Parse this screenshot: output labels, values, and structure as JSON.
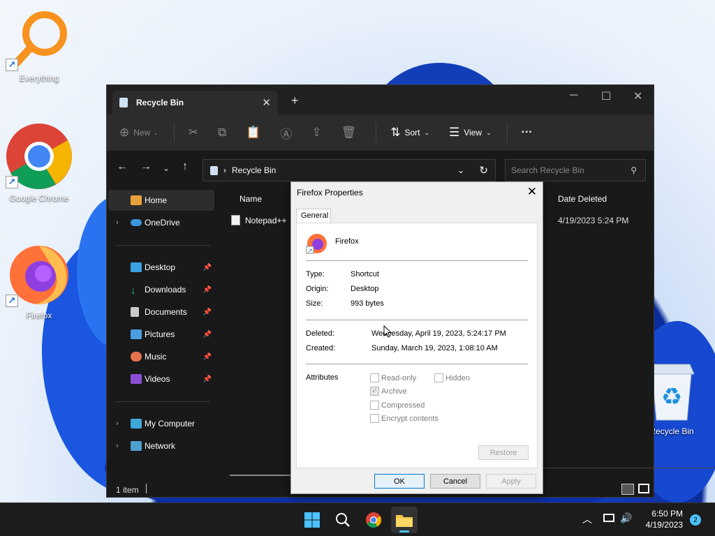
{
  "desktop": {
    "icons": [
      {
        "label": "Everything",
        "icon": "magnifier-icon"
      },
      {
        "label": "Google Chrome",
        "icon": "chrome-icon"
      },
      {
        "label": "Firefox",
        "icon": "firefox-icon"
      },
      {
        "label": "Recycle Bin",
        "icon": "recycle-bin-icon"
      }
    ]
  },
  "explorer": {
    "tab_title": "Recycle Bin",
    "toolbar": {
      "new_label": "New",
      "sort_label": "Sort",
      "view_label": "View",
      "more_label": "···"
    },
    "address": {
      "path": "Recycle Bin"
    },
    "search_placeholder": "Search Recycle Bin",
    "sidebar": {
      "items": [
        {
          "label": "Home"
        },
        {
          "label": "OneDrive"
        },
        {
          "label": "Desktop"
        },
        {
          "label": "Downloads"
        },
        {
          "label": "Documents"
        },
        {
          "label": "Pictures"
        },
        {
          "label": "Music"
        },
        {
          "label": "Videos"
        },
        {
          "label": "My Computer"
        },
        {
          "label": "Network"
        }
      ]
    },
    "columns": {
      "name": "Name",
      "date_deleted": "Date Deleted"
    },
    "files": [
      {
        "name": "Notepad++",
        "date_deleted": "4/19/2023 5:24 PM"
      }
    ],
    "status": "1 item"
  },
  "dialog": {
    "title": "Firefox Properties",
    "tab": "General",
    "file_name": "Firefox",
    "type_label": "Type:",
    "type_value": "Shortcut",
    "origin_label": "Origin:",
    "origin_value": "Desktop",
    "size_label": "Size:",
    "size_value": "993 bytes",
    "deleted_label": "Deleted:",
    "deleted_value": "Wednesday, April 19, 2023, 5:24:17 PM",
    "created_label": "Created:",
    "created_value": "Sunday, March 19, 2023, 1:08:10 AM",
    "attributes_label": "Attributes",
    "attr_readonly": "Read-only",
    "attr_hidden": "Hidden",
    "attr_archive": "Archive",
    "attr_compressed": "Compressed",
    "attr_encrypt": "Encrypt contents",
    "restore_label": "Restore",
    "ok_label": "OK",
    "cancel_label": "Cancel",
    "apply_label": "Apply"
  },
  "taskbar": {
    "time": "6:50 PM",
    "date": "4/19/2023",
    "notification_count": "2"
  },
  "colors": {
    "accent": "#0078d4",
    "explorer_bg": "#191919",
    "taskbar_bg": "#1c1c1c"
  }
}
